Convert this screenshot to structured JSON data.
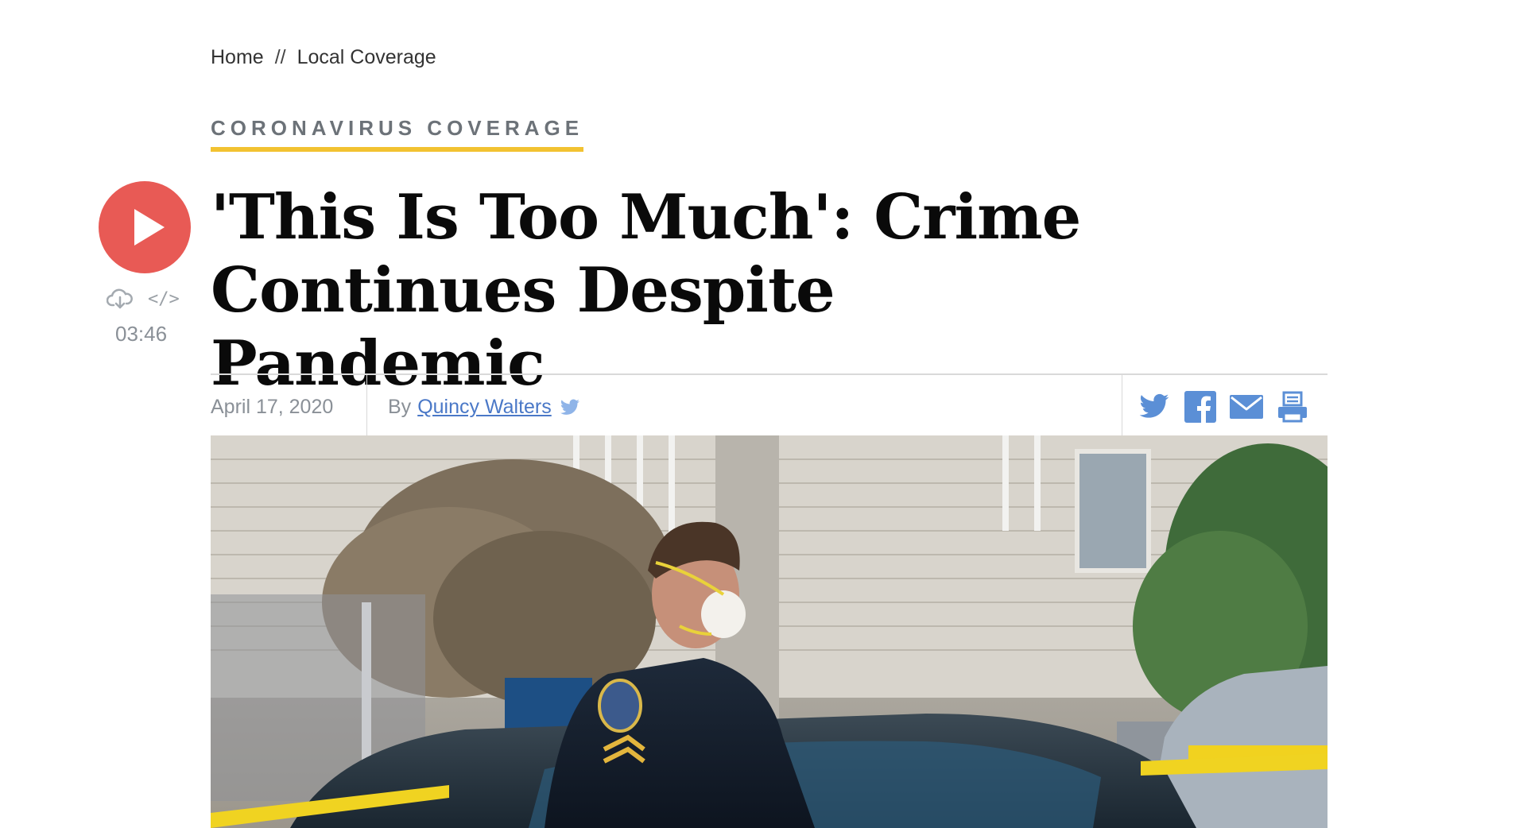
{
  "breadcrumb": {
    "items": [
      "Home",
      "Local Coverage"
    ],
    "separator": "//"
  },
  "section_tag": "CORONAVIRUS COVERAGE",
  "audio": {
    "duration": "03:46",
    "embed_label": "</>"
  },
  "headline": "'This Is Too Much': Crime Continues Despite Pandemic",
  "meta": {
    "date": "April 17, 2020",
    "by_prefix": "By",
    "author": "Quincy Walters"
  },
  "share": [
    "twitter-icon",
    "facebook-icon",
    "email-icon",
    "print-icon"
  ],
  "colors": {
    "accent_yellow": "#f2c231",
    "play_red": "#e85a55",
    "link_blue": "#4a78c7",
    "icon_blue": "#5b8fd6"
  }
}
